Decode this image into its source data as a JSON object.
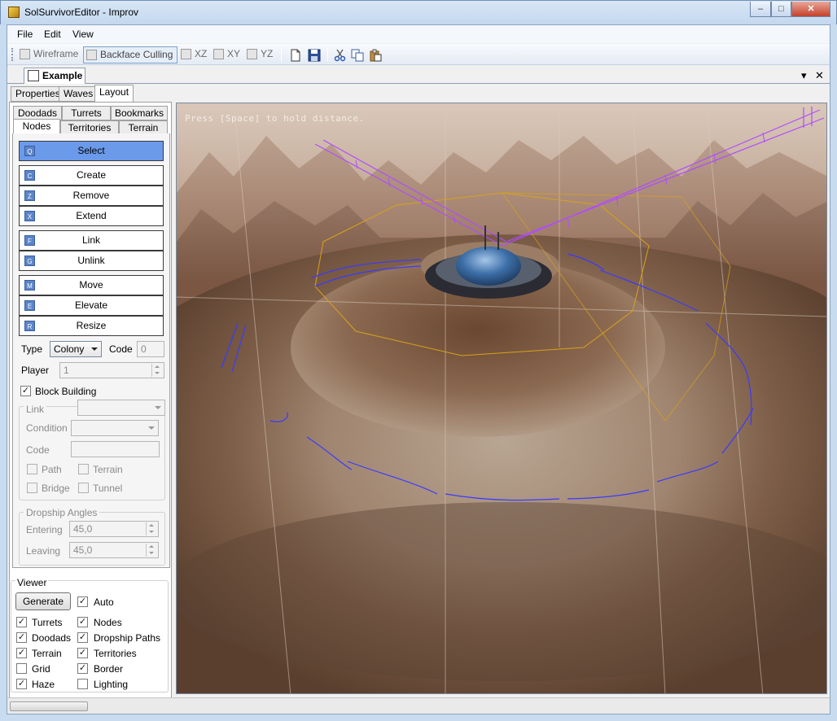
{
  "window": {
    "title": "SolSurvivorEditor - Improv",
    "min": "‒",
    "max": "□",
    "close": "✕"
  },
  "menu": [
    "File",
    "Edit",
    "View"
  ],
  "toolbar": {
    "wireframe": "Wireframe",
    "backface": "Backface Culling",
    "xz": "XZ",
    "xy": "XY",
    "yz": "YZ"
  },
  "document": {
    "tab": "Example",
    "dropdown_glyph": "▾",
    "close_glyph": "✕"
  },
  "outer_tabs": [
    "Properties",
    "Waves",
    "Layout"
  ],
  "inner_tabs": {
    "row1": [
      "Doodads",
      "Turrets",
      "Bookmarks"
    ],
    "row2": [
      "Nodes",
      "Territories",
      "Terrain"
    ]
  },
  "tools": [
    {
      "key": "Q",
      "label": "Select"
    },
    {
      "key": "C",
      "label": "Create"
    },
    {
      "key": "Z",
      "label": "Remove"
    },
    {
      "key": "X",
      "label": "Extend"
    },
    {
      "key": "F",
      "label": "Link"
    },
    {
      "key": "G",
      "label": "Unlink"
    },
    {
      "key": "M",
      "label": "Move"
    },
    {
      "key": "E",
      "label": "Elevate"
    },
    {
      "key": "R",
      "label": "Resize"
    }
  ],
  "props": {
    "type_label": "Type",
    "type_value": "Colony",
    "code_label": "Code",
    "code_value": "0",
    "player_label": "Player",
    "player_value": "1",
    "block_building": "Block Building",
    "link_group": "Link",
    "condition": "Condition",
    "code2": "Code",
    "path": "Path",
    "terrain": "Terrain",
    "bridge": "Bridge",
    "tunnel": "Tunnel",
    "dropship_group": "Dropship Angles",
    "entering": "Entering",
    "entering_value": "45,0",
    "leaving": "Leaving",
    "leaving_value": "45,0"
  },
  "viewer": {
    "title": "Viewer",
    "generate": "Generate",
    "auto": "Auto",
    "turrets": "Turrets",
    "nodes": "Nodes",
    "doodads": "Doodads",
    "dropship_paths": "Dropship Paths",
    "terrain": "Terrain",
    "territories": "Territories",
    "grid": "Grid",
    "border": "Border",
    "haze": "Haze",
    "lighting": "Lighting"
  },
  "viewport": {
    "hint": "Press [Space] to hold distance."
  },
  "check_glyph": "✓",
  "colors": {
    "selected_tool": "#6b9aeb",
    "node_path": "#3a3aff",
    "dropship_path": "#b04cff",
    "territory": "#d8a21a"
  }
}
